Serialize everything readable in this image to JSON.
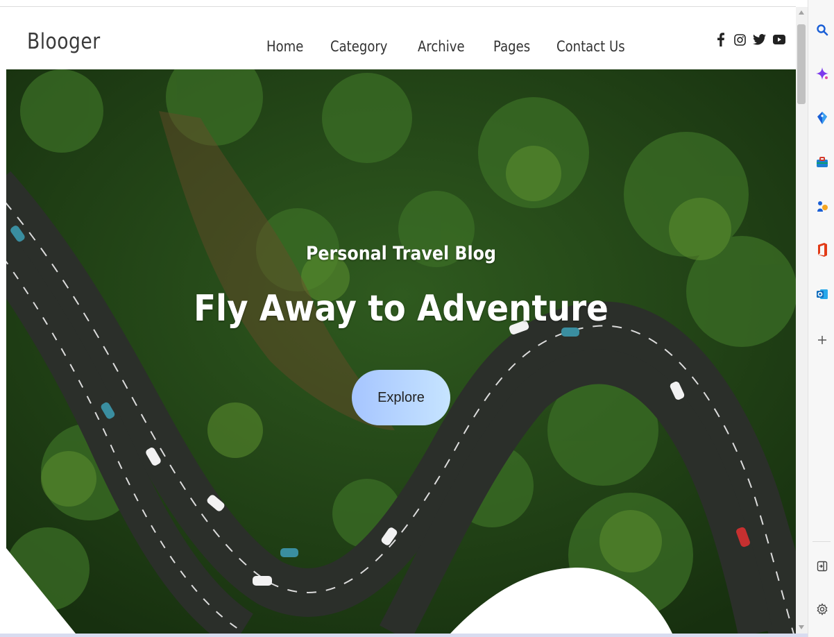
{
  "navbar": {
    "brand": "Blooger",
    "links": [
      "Home",
      "Category",
      "Archive",
      "Pages",
      "Contact Us"
    ],
    "socials": [
      "facebook-icon",
      "instagram-icon",
      "twitter-icon",
      "youtube-icon"
    ]
  },
  "hero": {
    "subtitle": "Personal Travel Blog",
    "title": "Fly Away to Adventure",
    "cta_label": "Explore"
  },
  "edge_sidebar": {
    "icons": [
      "search-icon",
      "copilot-icon",
      "shopping-tag-icon",
      "toolbox-icon",
      "games-icon",
      "office-icon",
      "outlook-icon",
      "add-icon",
      "sidebar-collapse-icon",
      "settings-icon"
    ]
  },
  "colors": {
    "forest_dark": "#1f3a17",
    "forest_mid": "#2f5a1f",
    "road": "#2b2f2a",
    "button_gradient_start": "#a6c5ff",
    "button_gradient_end": "#c6e4ff"
  }
}
